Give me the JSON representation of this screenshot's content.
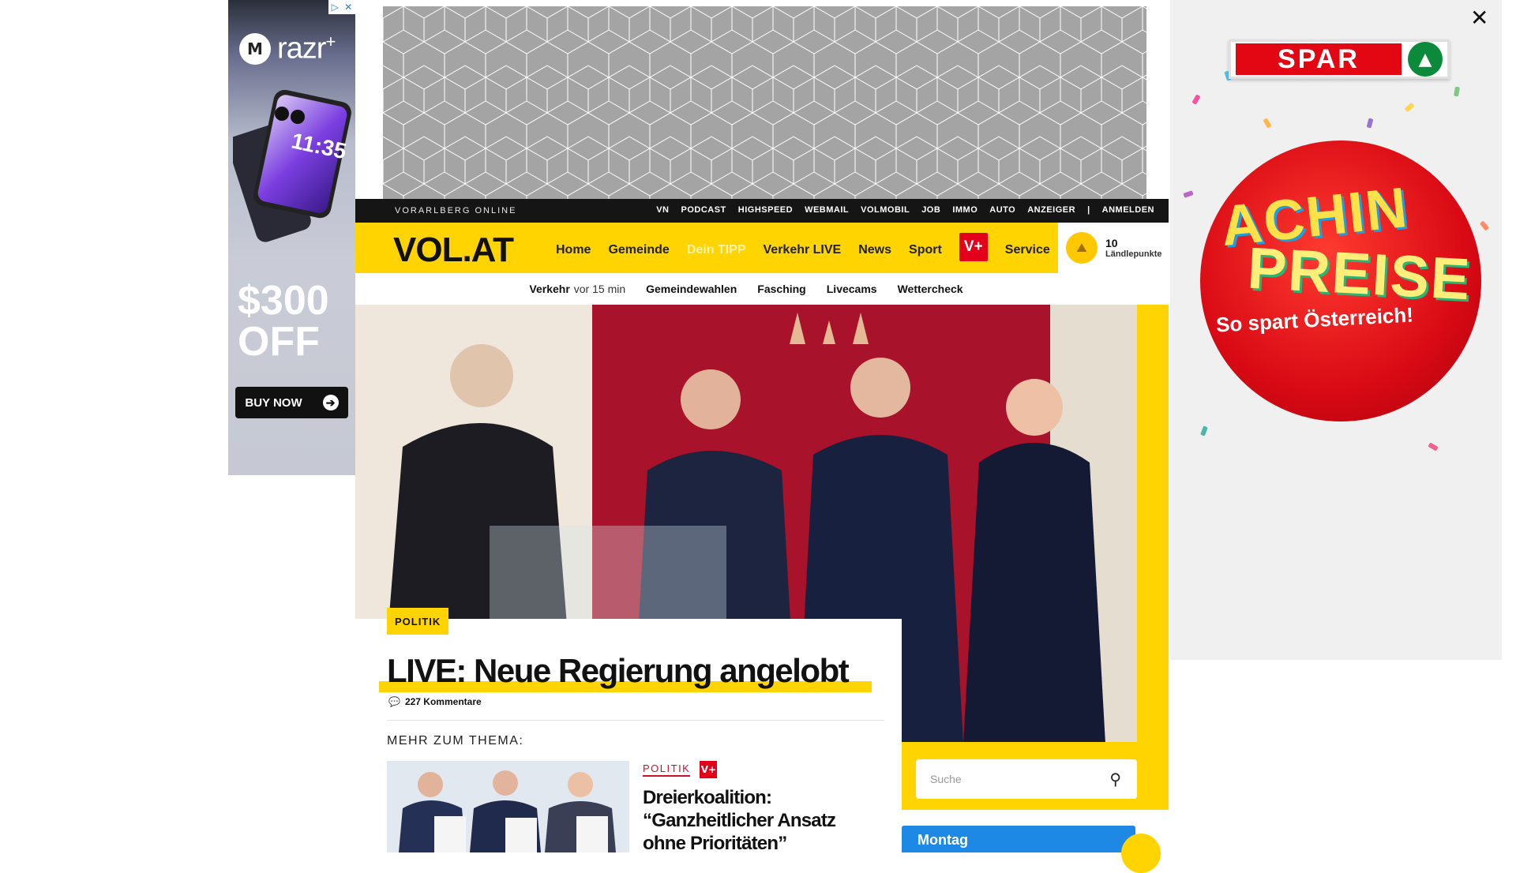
{
  "left_ad": {
    "adchoices_icons": [
      "adchoices-triangle-icon",
      "close-x-icon"
    ],
    "brand": "razr",
    "brand_sup": "+",
    "phone_time": "11:35",
    "price_line1": "$300",
    "price_line2": "OFF",
    "cta": "BUY NOW"
  },
  "top_banner": {
    "pattern": "isometric-cube",
    "color": "#a4a4a4"
  },
  "topbar": {
    "site_name": "VORARLBERG ONLINE",
    "links": [
      "VN",
      "PODCAST",
      "HIGHSPEED",
      "WEBMAIL",
      "VOLMOBIL",
      "JOB",
      "IMMO",
      "AUTO",
      "ANZEIGER"
    ],
    "separator": "|",
    "login": "ANMELDEN"
  },
  "mainnav": {
    "logo": "VOL.AT",
    "items": [
      "Home",
      "Gemeinde",
      "Dein TIPP",
      "Verkehr LIVE",
      "News",
      "Sport"
    ],
    "vplus": "V+",
    "service": "Service",
    "points_value": "10",
    "points_label": "Ländlepunkte"
  },
  "subnav": {
    "traffic_label": "Verkehr",
    "traffic_time": "vor 15 min",
    "items": [
      "Gemeindewahlen",
      "Fasching",
      "Livecams",
      "Wettercheck"
    ]
  },
  "article": {
    "category": "POLITIK",
    "headline": "LIVE: Neue Regierung angelobt",
    "comments": "227 Kommentare",
    "more_label": "MEHR ZUM THEMA:",
    "related": {
      "category": "POLITIK",
      "badge": "V+",
      "title": "Dreierkoalition: “Ganzheitlicher Ansatz ohne Prioritäten”"
    }
  },
  "search": {
    "placeholder": "Suche"
  },
  "weather": {
    "day": "Montag"
  },
  "right_ad": {
    "close": "✕",
    "brand": "SPAR",
    "line1": "ACHIN",
    "line2": "PREISE",
    "slogan": "So spart Österreich!"
  },
  "colors": {
    "accent_yellow": "#ffd400",
    "brand_red": "#e3001b",
    "weather_blue": "#1e88e5",
    "spar_red": "#e30613"
  }
}
